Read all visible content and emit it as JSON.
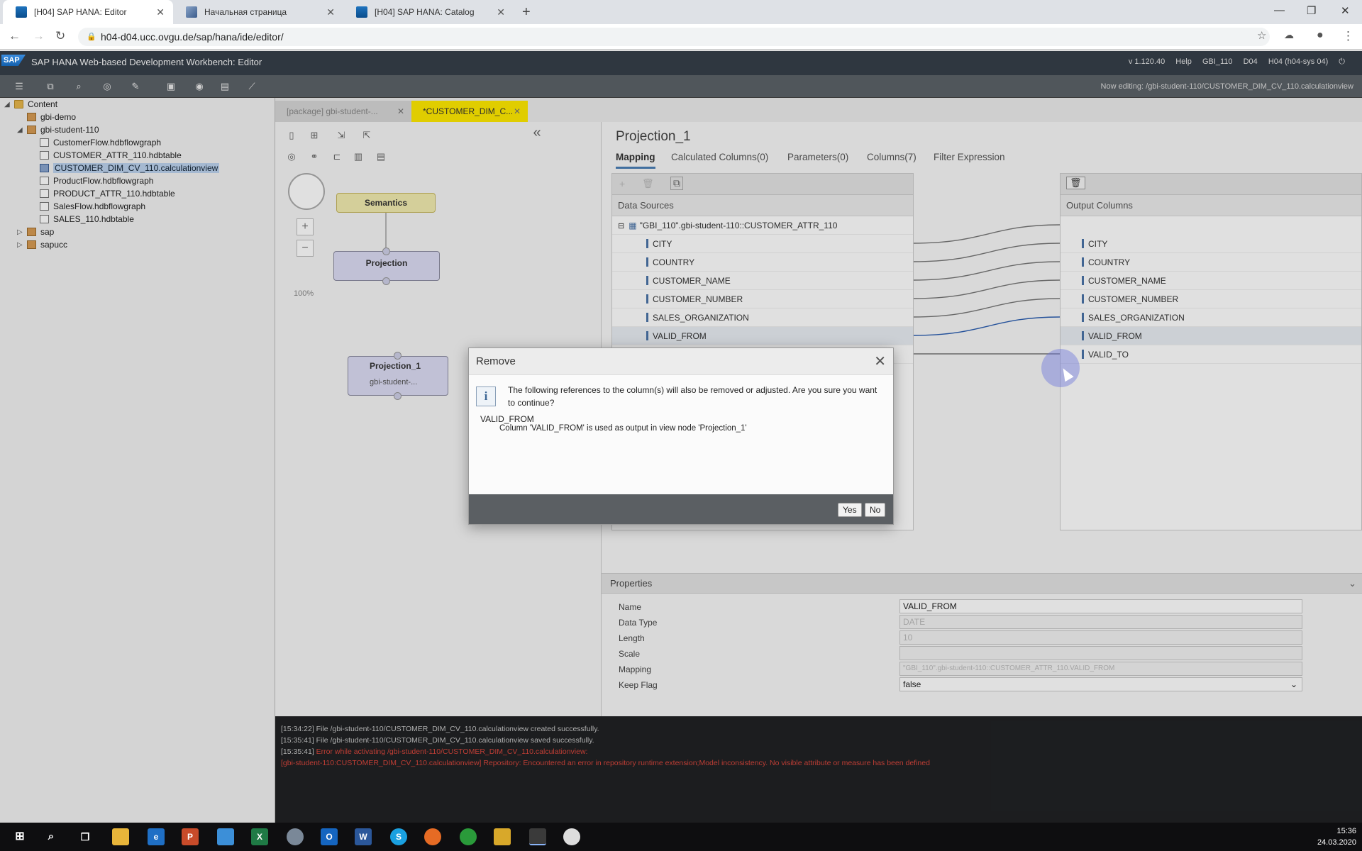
{
  "browser": {
    "tabs": [
      {
        "label": "[H04] SAP HANA: Editor",
        "active": true
      },
      {
        "label": "Начальная страница",
        "active": false
      },
      {
        "label": "[H04] SAP HANA: Catalog",
        "active": false
      }
    ],
    "url": "h04-d04.ucc.ovgu.de/sap/hana/ide/editor/"
  },
  "app": {
    "logo": "SAP",
    "title": "SAP HANA Web-based Development Workbench: Editor",
    "header_links": [
      "v 1.120.40",
      "Help",
      "GBI_110",
      "D04",
      "H04 (h04-sys 04)"
    ],
    "now_editing": "Now editing: /gbi-student-110/CUSTOMER_DIM_CV_110.calculationview"
  },
  "tree": {
    "root": "Content",
    "items": [
      {
        "label": "gbi-demo"
      },
      {
        "label": "gbi-student-110"
      },
      {
        "label": "CustomerFlow.hdbflowgraph"
      },
      {
        "label": "CUSTOMER_ATTR_110.hdbtable"
      },
      {
        "label": "CUSTOMER_DIM_CV_110.calculationview"
      },
      {
        "label": "ProductFlow.hdbflowgraph"
      },
      {
        "label": "PRODUCT_ATTR_110.hdbtable"
      },
      {
        "label": "SalesFlow.hdbflowgraph"
      },
      {
        "label": "SALES_110.hdbtable"
      },
      {
        "label": "sap"
      },
      {
        "label": "sapucc"
      }
    ]
  },
  "editor": {
    "tabs": [
      {
        "label": "[package] gbi-student-..."
      },
      {
        "label": "*CUSTOMER_DIM_C..."
      }
    ],
    "canvas": {
      "zoom": "100%",
      "nodes": {
        "semantics": "Semantics",
        "projection": "Projection",
        "projection1": "Projection_1",
        "projection1_source": "gbi-student-..."
      }
    },
    "detail": {
      "title": "Projection_1",
      "tabs": [
        "Mapping",
        "Calculated Columns(0)",
        "Parameters(0)",
        "Columns(7)",
        "Filter Expression"
      ],
      "data_sources_header": "Data Sources",
      "source_table": "\"GBI_110\".gbi-student-110::CUSTOMER_ATTR_110",
      "source_columns": [
        "CITY",
        "COUNTRY",
        "CUSTOMER_NAME",
        "CUSTOMER_NUMBER",
        "SALES_ORGANIZATION",
        "VALID_FROM",
        "VALID_TO"
      ],
      "output_header": "Output Columns",
      "output_columns": [
        "CITY",
        "COUNTRY",
        "CUSTOMER_NAME",
        "CUSTOMER_NUMBER",
        "SALES_ORGANIZATION",
        "VALID_FROM",
        "VALID_TO"
      ]
    },
    "properties": {
      "header": "Properties",
      "rows": [
        {
          "label": "Name",
          "value": "VALID_FROM"
        },
        {
          "label": "Data Type",
          "value": "DATE"
        },
        {
          "label": "Length",
          "value": "10"
        },
        {
          "label": "Scale",
          "value": ""
        },
        {
          "label": "Mapping",
          "value": "\"GBI_110\".gbi-student-110::CUSTOMER_ATTR_110.VALID_FROM"
        },
        {
          "label": "Keep Flag",
          "value": "false"
        }
      ]
    }
  },
  "console": {
    "lines": [
      {
        "text": "[15:34:22] File /gbi-student-110/CUSTOMER_DIM_CV_110.calculationview created successfully."
      },
      {
        "text": "[15:35:41] File /gbi-student-110/CUSTOMER_DIM_CV_110.calculationview saved successfully."
      },
      {
        "prefix": "[15:35:41] ",
        "text": "Error while activating /gbi-student-110/CUSTOMER_DIM_CV_110.calculationview:"
      },
      {
        "text": "[gbi-student-110:CUSTOMER_DIM_CV_110.calculationview] Repository: Encountered an error in repository runtime extension;Model inconsistency. No visible attribute or measure has been defined"
      }
    ]
  },
  "dialog": {
    "title": "Remove",
    "message": "The following references to the column(s) will also be removed or adjusted. Are you sure you want to continue?",
    "column": "VALID_FROM",
    "detail": "Column 'VALID_FROM' is used as output in view node 'Projection_1'",
    "yes_label": "Yes",
    "no_label": "No"
  },
  "taskbar": {
    "time": "15:36",
    "date": "24.03.2020"
  }
}
